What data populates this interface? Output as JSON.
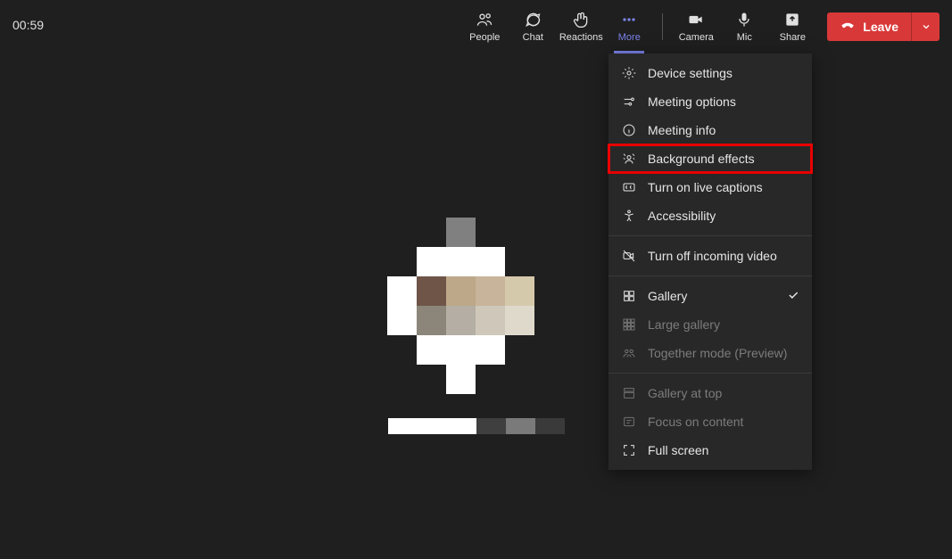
{
  "timer": "00:59",
  "toolbar": {
    "people": "People",
    "chat": "Chat",
    "reactions": "Reactions",
    "more": "More",
    "camera": "Camera",
    "mic": "Mic",
    "share": "Share"
  },
  "leave": {
    "label": "Leave"
  },
  "more_menu": {
    "device_settings": "Device settings",
    "meeting_options": "Meeting options",
    "meeting_info": "Meeting info",
    "background_effects": "Background effects",
    "live_captions": "Turn on live captions",
    "accessibility": "Accessibility",
    "turn_off_incoming": "Turn off incoming video",
    "gallery": "Gallery",
    "large_gallery": "Large gallery",
    "together_mode": "Together mode (Preview)",
    "gallery_at_top": "Gallery at top",
    "focus_on_content": "Focus on content",
    "full_screen": "Full screen"
  }
}
